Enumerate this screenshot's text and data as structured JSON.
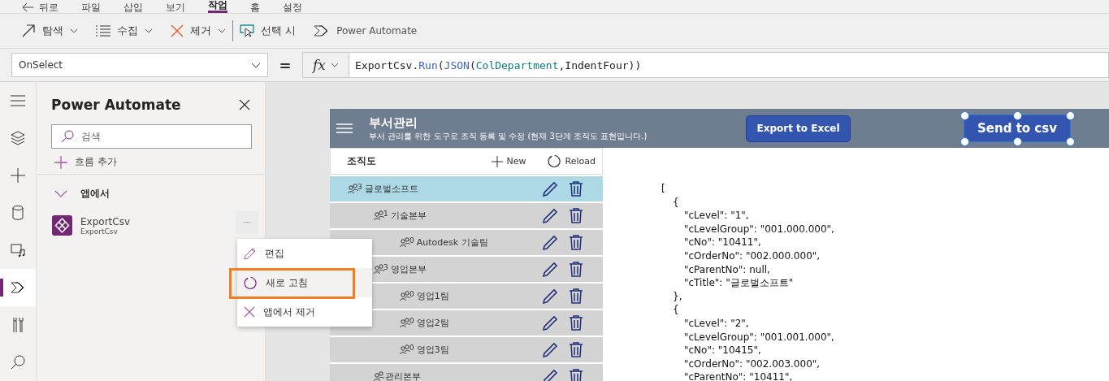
{
  "menu_bar": {
    "back": "뒤로",
    "items": [
      {
        "label": "파일",
        "selected": false
      },
      {
        "label": "삽입",
        "selected": false
      },
      {
        "label": "보기",
        "selected": false
      },
      {
        "label": "작업",
        "selected": true
      },
      {
        "label": "홈",
        "selected": false
      },
      {
        "label": "설정",
        "selected": false
      }
    ]
  },
  "toolbar": [
    {
      "kind": "navigate",
      "label": "탐색",
      "dropdown": true
    },
    {
      "kind": "collect",
      "label": "수집",
      "dropdown": true
    },
    {
      "kind": "remove",
      "label": "제거",
      "dropdown": true
    },
    {
      "kind": "onselect",
      "label": "선택 시",
      "dropdown": false
    },
    {
      "kind": "automate",
      "label": "Power Automate",
      "dropdown": false
    }
  ],
  "formula_bar": {
    "property": "OnSelect",
    "equals": "=",
    "fx": "fx",
    "tokens": [
      {
        "kind": "plain",
        "text": "ExportCsv."
      },
      {
        "kind": "function",
        "text": "Run"
      },
      {
        "kind": "plain",
        "text": "("
      },
      {
        "kind": "function",
        "text": "JSON"
      },
      {
        "kind": "plain",
        "text": "("
      },
      {
        "kind": "variable",
        "text": "ColDepartment"
      },
      {
        "kind": "plain",
        "text": ",IndentFour))"
      }
    ]
  },
  "rail": [
    {
      "kind": "menu",
      "selected": false
    },
    {
      "kind": "layers",
      "selected": false
    },
    {
      "kind": "insert",
      "selected": false
    },
    {
      "kind": "data",
      "selected": false
    },
    {
      "kind": "media",
      "selected": false
    },
    {
      "kind": "automate",
      "selected": true
    },
    {
      "kind": "tools",
      "selected": false
    },
    {
      "kind": "search",
      "selected": false
    }
  ],
  "panel": {
    "title": "Power Automate",
    "search": {
      "placeholder": "검색"
    },
    "add_flow": "흐름 추가",
    "section": {
      "label": "앱에서",
      "expanded": true
    },
    "flows": [
      {
        "name": "ExportCsv",
        "subtitle": "ExportCsv",
        "more": "···"
      }
    ],
    "context_menu": [
      {
        "kind": "edit",
        "label": "편집",
        "hovered": false,
        "highlighted": false
      },
      {
        "kind": "refresh",
        "label": "새로 고침",
        "hovered": true,
        "highlighted": true
      },
      {
        "kind": "remove",
        "label": "앱에서 제거",
        "hovered": false,
        "highlighted": false
      }
    ]
  },
  "app": {
    "title": "부서관리",
    "subtitle": "부서 관리를 위한 도구로 조직 등록 및 수정 (현재 3단계 조직도 표현입니다.)",
    "export_button": "Export to Excel",
    "send_button": {
      "label": "Send to csv",
      "selected": true
    },
    "tree": {
      "title": "조직도",
      "new": "New",
      "reload": "Reload",
      "rows": [
        {
          "name": "글로벌소프트",
          "count": "3",
          "selected": true,
          "children": [
            {
              "name": "기술본부",
              "count": "1",
              "selected": false,
              "children": [
                {
                  "name": "Autodesk 기술팀",
                  "count": "0",
                  "selected": false
                }
              ]
            },
            {
              "name": "영업본부",
              "count": "3",
              "selected": false,
              "children": [
                {
                  "name": "영업1팀",
                  "count": "0",
                  "selected": false
                },
                {
                  "name": "영업2팀",
                  "count": "0",
                  "selected": false
                },
                {
                  "name": "영업3팀",
                  "count": "0",
                  "selected": false
                }
              ]
            },
            {
              "name": "관리본부",
              "selected": false
            }
          ]
        }
      ]
    },
    "json_preview": [
      {
        "open": "[",
        "children": [
          {
            "open": "{",
            "close": "},",
            "children": [
              "\"cLevel\": \"1\",",
              "\"cLevelGroup\": \"001.000.000\",",
              "\"cNo\": \"10411\",",
              "\"cOrderNo\": \"002.000.000\",",
              "\"cParentNo\": null,",
              "\"cTitle\": \"글로벌소프트\""
            ]
          },
          {
            "open": "{",
            "children": [
              "\"cLevel\": \"2\",",
              "\"cLevelGroup\": \"001.001.000\",",
              "\"cNo\": \"10415\",",
              "\"cOrderNo\": \"002.003.000\",",
              "\"cParentNo\": \"10411\","
            ]
          }
        ]
      }
    ]
  }
}
